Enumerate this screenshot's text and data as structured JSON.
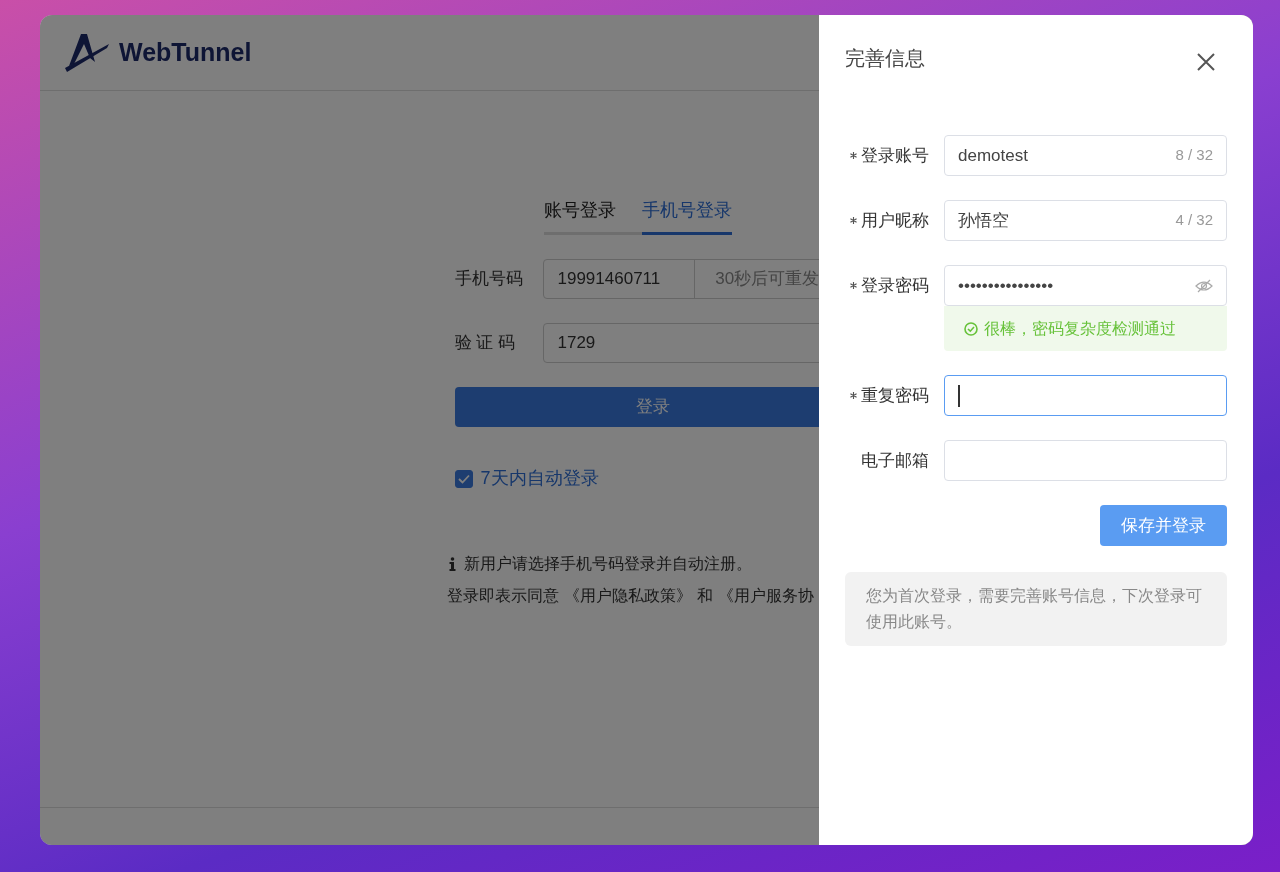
{
  "app": {
    "logo_text": "WebTunnel"
  },
  "login": {
    "tabs": [
      {
        "label": "账号登录",
        "selected": false
      },
      {
        "label": "手机号登录",
        "selected": true
      }
    ],
    "phone": {
      "label": "手机号码",
      "value": "19991460711",
      "send_code": "30秒后可重发"
    },
    "code": {
      "label": "验 证 码",
      "value": "1729"
    },
    "submit": "登录",
    "remember": {
      "label": "7天内自动登录",
      "checked": true
    },
    "notice": "新用户请选择手机号码登录并自动注册。",
    "agreement": {
      "text": "登录即表示同意",
      "privacy_link": "《用户隐私政策》",
      "and": "和",
      "terms_link": "《用户服务协"
    }
  },
  "drawer": {
    "title": "完善信息",
    "fields": [
      {
        "kind": "text",
        "label": "登录账号",
        "required": true,
        "value": "demotest",
        "counter": "8 / 32",
        "focused": false
      },
      {
        "kind": "text",
        "label": "用户昵称",
        "required": true,
        "value": "孙悟空",
        "counter": "4 / 32",
        "focused": false
      },
      {
        "kind": "password",
        "label": "登录密码",
        "required": true,
        "value": "••••••••••••••••",
        "hint": "很棒，密码复杂度检测通过",
        "focused": false
      },
      {
        "kind": "password",
        "label": "重复密码",
        "required": true,
        "focused": true
      },
      {
        "kind": "text",
        "label": "电子邮箱",
        "required": false,
        "focused": false
      }
    ],
    "submit": "保存并登录",
    "info": "您为首次登录，需要完善账号信息，下次登录可使用此账号。"
  }
}
